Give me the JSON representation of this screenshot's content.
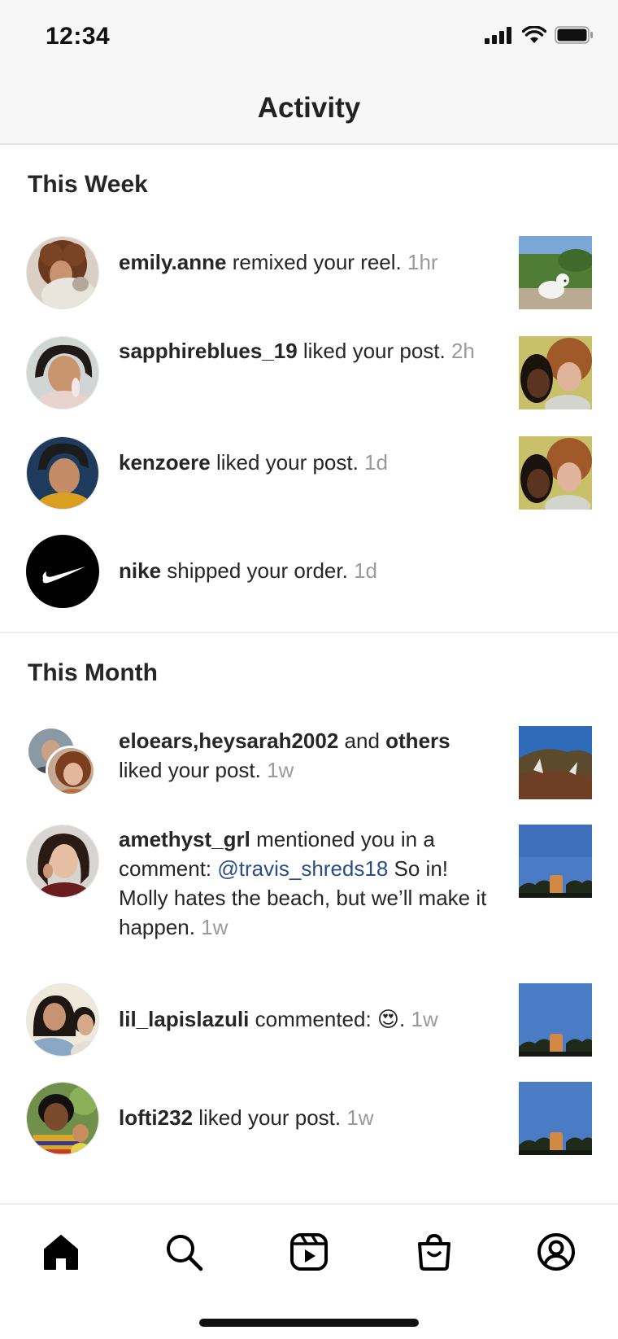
{
  "status_bar": {
    "time": "12:34"
  },
  "header": {
    "title": "Activity"
  },
  "sections": [
    {
      "title": "This Week",
      "items": [
        {
          "user": "emily.anne",
          "action": " remixed your reel. ",
          "time": "1hr"
        },
        {
          "user": "sapphireblues_19",
          "action": " liked your post. ",
          "time": "2h"
        },
        {
          "user": "kenzoere",
          "action": " liked your post. ",
          "time": "1d"
        },
        {
          "user": "nike",
          "action": " shipped your order. ",
          "time": "1d"
        }
      ]
    },
    {
      "title": "This Month",
      "items": [
        {
          "user": "eloears,heysarah2002",
          "mid": " and ",
          "user2": "others",
          "action": " liked your post. ",
          "time": "1w"
        },
        {
          "user": "amethyst_grl",
          "action": " mentioned you in a comment: ",
          "mention": "@travis_shreds18",
          "comment": " So in! Molly hates the beach, but we’ll make it happen. ",
          "time": "1w"
        },
        {
          "user": "lil_lapislazuli",
          "action": " commented: ",
          "emoji": "😍",
          "after": ". ",
          "time": "1w"
        },
        {
          "user": "lofti232",
          "action": " liked your post. ",
          "time": "1w"
        }
      ]
    }
  ],
  "tab_bar": {
    "items": [
      "home-icon",
      "search-icon",
      "reels-icon",
      "shop-icon",
      "profile-icon"
    ],
    "active": "home-icon"
  },
  "colors": {
    "mention": "#2a4f86",
    "time": "#9a9a9a",
    "header_bg": "#f7f7f7"
  }
}
